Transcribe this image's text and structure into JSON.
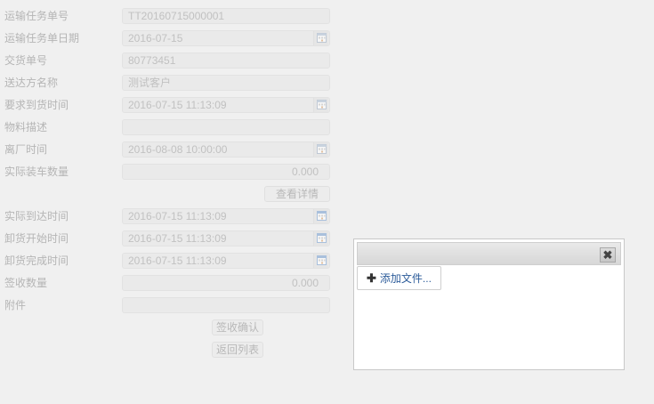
{
  "form": {
    "fields": [
      {
        "label": "运输任务单号",
        "value": "TT20160715000001"
      },
      {
        "label": "运输任务单日期",
        "value": "2016-07-15"
      },
      {
        "label": "交货单号",
        "value": "80773451"
      },
      {
        "label": "送达方名称",
        "value": "测试客户"
      },
      {
        "label": "要求到货时间",
        "value": "2016-07-15 11:13:09"
      },
      {
        "label": "物料描述",
        "value": ""
      },
      {
        "label": "离厂时间",
        "value": "2016-08-08 10:00:00"
      },
      {
        "label": "实际装车数量",
        "value": "0.000"
      },
      {
        "label": "实际到达时间",
        "value": "2016-07-15 11:13:09"
      },
      {
        "label": "卸货开始时间",
        "value": "2016-07-15 11:13:09"
      },
      {
        "label": "卸货完成时间",
        "value": "2016-07-15 11:13:09"
      },
      {
        "label": "签收数量",
        "value": "0.000"
      },
      {
        "label": "附件",
        "value": ""
      }
    ],
    "view_details_label": "查看详情",
    "confirm_receipt_label": "签收确认",
    "back_to_list_label": "返回列表"
  },
  "upload": {
    "close_icon": "close-icon",
    "close_glyph": "✖",
    "add_icon": "plus-icon",
    "add_glyph": "✚",
    "add_file_label": "添加文件..."
  },
  "colors": {
    "page_bg": "#f0f0f0",
    "field_bg": "#eaeaea",
    "link_blue": "#2d5c9a"
  }
}
